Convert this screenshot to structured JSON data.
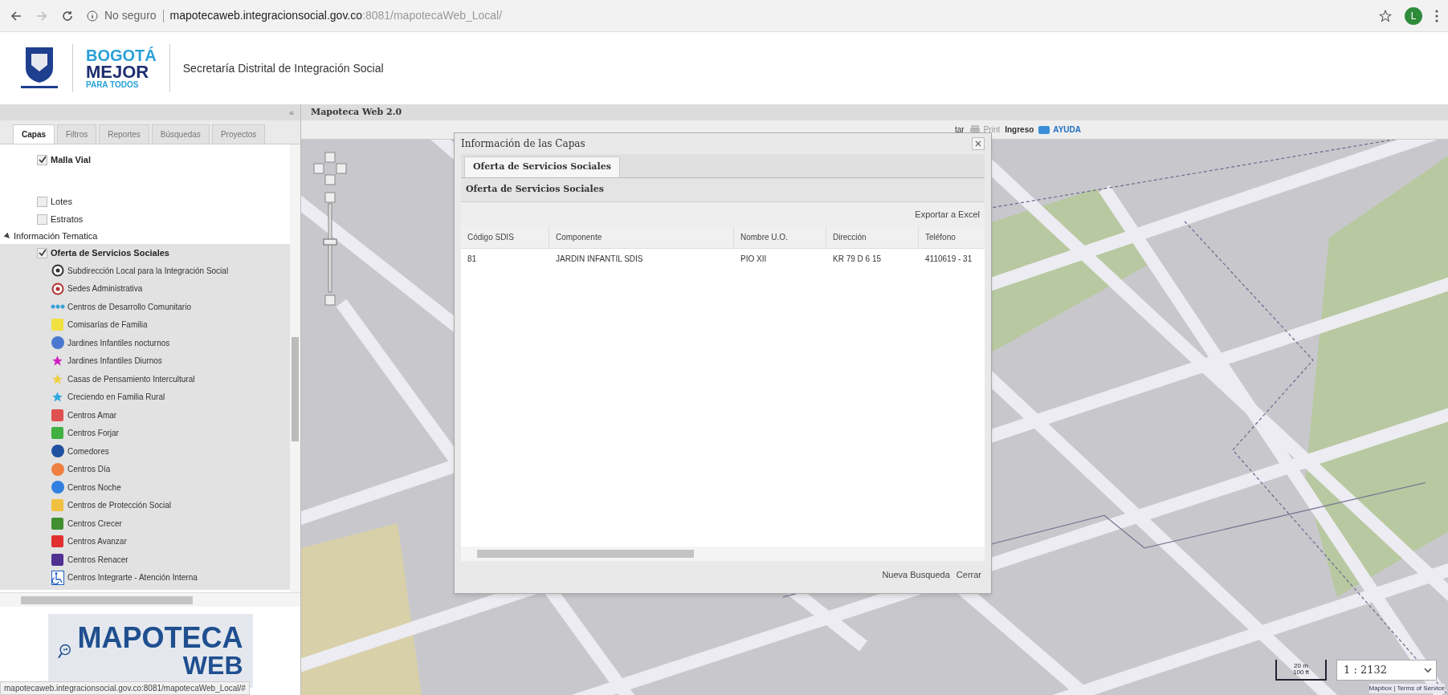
{
  "browser": {
    "security": "No seguro",
    "url_host": "mapotecaweb.integracionsocial.gov.co",
    "url_rest": ":8081/mapotecaWeb_Local/",
    "profile": "L"
  },
  "header": {
    "logo_small": "BOGOTÁ",
    "logo_big": "MEJOR",
    "logo_sub": "PARA TODOS",
    "title": "Secretaría Distrital de Integración Social"
  },
  "panel_title": "Mapoteca Web 2.0",
  "collapse": "«",
  "tabs": [
    {
      "label": "Capas",
      "selected": true
    },
    {
      "label": "Filtros",
      "selected": false
    },
    {
      "label": "Reportes",
      "selected": false
    },
    {
      "label": "Búsquedas",
      "selected": false
    },
    {
      "label": "Proyectos",
      "selected": false
    }
  ],
  "tree": [
    {
      "label": "Malla Vial",
      "checked": true,
      "bold": true,
      "selected": false
    },
    {
      "label": "Lotes",
      "checked": false,
      "bold": false,
      "selected": false
    },
    {
      "label": "Estratos",
      "checked": false,
      "bold": false,
      "selected": false
    },
    {
      "label": "Información Tematica",
      "kind": "folder",
      "expanded": true,
      "children": [
        {
          "label": "Oferta de Servicios Sociales",
          "checked": true,
          "bold": true,
          "selected": true,
          "legend": [
            {
              "label": "Subdirección Local para la Integración Social",
              "kind": "ring",
              "color": "#333333"
            },
            {
              "label": "Sedes Administrativa",
              "kind": "ring",
              "color": "#b03030"
            },
            {
              "label": "Centros de Desarrollo Comunitario",
              "kind": "dots",
              "color": "#3aa0d8"
            },
            {
              "label": "Comisarías de Familia",
              "kind": "square",
              "color": "#f0e040"
            },
            {
              "label": "Jardines Infantiles nocturnos",
              "kind": "circle",
              "color": "#4a78d0"
            },
            {
              "label": "Jardines Infantiles Diurnos",
              "kind": "star",
              "color": "#d020c0"
            },
            {
              "label": "Casas de Pensamiento Intercultural",
              "kind": "star",
              "color": "#f0d040"
            },
            {
              "label": "Creciendo en Familia Rural",
              "kind": "star",
              "color": "#30a8e0"
            },
            {
              "label": "Centros Amar",
              "kind": "square",
              "color": "#e05050"
            },
            {
              "label": "Centros Forjar",
              "kind": "square",
              "color": "#40b040"
            },
            {
              "label": "Comedores",
              "kind": "circle",
              "color": "#2050a0"
            },
            {
              "label": "Centros Día",
              "kind": "circle",
              "color": "#f08040"
            },
            {
              "label": "Centros Noche",
              "kind": "circle",
              "color": "#3080e0"
            },
            {
              "label": "Centros de Protección Social",
              "kind": "square",
              "color": "#f0c040"
            },
            {
              "label": "Centros Crecer",
              "kind": "square",
              "color": "#409030"
            },
            {
              "label": "Centros Avanzar",
              "kind": "square",
              "color": "#e03030"
            },
            {
              "label": "Centros Renacer",
              "kind": "square",
              "color": "#503090"
            },
            {
              "label": "Centros Integrarte - Atención Interna",
              "kind": "wheelchair",
              "color": "#2060c0"
            }
          ]
        }
      ]
    }
  ],
  "logo": {
    "line1": "MAPOTECA",
    "line2": "WEB"
  },
  "status_url": "mapotecaweb.integracionsocial.gov.co:8081/mapotecaWeb_Local/#",
  "toolbar": {
    "cut_label": "tar",
    "print": "Print",
    "login": "Ingreso",
    "help": "AYUDA"
  },
  "dialog": {
    "title": "Información de las Capas",
    "tabs": [
      {
        "label": "Oferta de Servicios Sociales",
        "selected": true
      }
    ],
    "section": "Oferta de Servicios Sociales",
    "export": "Exportar a Excel",
    "columns": [
      "Código SDIS",
      "Componente",
      "Nombre U.O.",
      "Dirección",
      "Teléfono"
    ],
    "rows": [
      [
        "81",
        "JARDIN INFANTIL SDIS",
        "PIO XII",
        "KR 79 D 6 15",
        "4110619 - 31"
      ]
    ],
    "buttons": [
      "Nueva Busqueda",
      "Cerrar"
    ]
  },
  "scale": {
    "metric": "20 m",
    "imperial": "100 ft",
    "ratio": "1 : 2132",
    "attribution": "Mapbox | Terms of Service"
  }
}
